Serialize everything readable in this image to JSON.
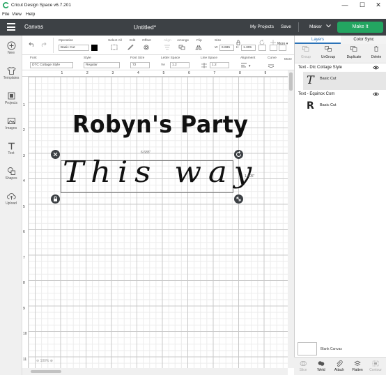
{
  "window": {
    "title": "Cricut Design Space  v6.7.201",
    "minimize": "—",
    "maximize": "☐",
    "close": "✕"
  },
  "menu": [
    "File",
    "View",
    "Help"
  ],
  "header": {
    "section": "Canvas",
    "document_title": "Untitled*",
    "my_projects": "My Projects",
    "save": "Save",
    "machine": "Maker",
    "make_it": "Make It",
    "make_it_color": "#23a561"
  },
  "sidebar": {
    "items": [
      {
        "label": "New",
        "icon": "plus-icon"
      },
      {
        "label": "Templates",
        "icon": "shirt-icon"
      },
      {
        "label": "Projects",
        "icon": "projects-icon"
      },
      {
        "label": "Images",
        "icon": "image-icon"
      },
      {
        "label": "Text",
        "icon": "text-icon"
      },
      {
        "label": "Shapes",
        "icon": "shapes-icon"
      },
      {
        "label": "Upload",
        "icon": "upload-icon"
      }
    ]
  },
  "toolbar": {
    "operation_label": "Operation",
    "operation_value": "Basic Cut",
    "operation_color": "#000000",
    "select_all": "Select All",
    "edit": "Edit",
    "offset": "Offset",
    "align": "Align",
    "arrange": "Arrange",
    "flip": "Flip",
    "size_label": "Size",
    "width_prefix": "W",
    "width_value": "6.685",
    "height_prefix": "H",
    "height_value": "1.305",
    "rotate": "Rotate",
    "position": "Position",
    "more": "More"
  },
  "text_toolbar": {
    "font_label": "Font",
    "font_value": "DTC Cottage Style",
    "style_label": "Style",
    "style_value": "Regular",
    "font_size_label": "Font Size",
    "font_size_value": "72",
    "letter_space_label": "Letter Space",
    "letter_space_prefix": "VA",
    "letter_space_value": "1.2",
    "line_space_label": "Line Space",
    "line_space_value": "1.2",
    "alignment_label": "Alignment",
    "curve_label": "Curve",
    "more": "More"
  },
  "canvas": {
    "ruler_top": [
      "1",
      "2",
      "3",
      "4",
      "5",
      "6",
      "7",
      "8",
      "9"
    ],
    "ruler_left": [
      "1",
      "2",
      "3",
      "4",
      "5",
      "6",
      "7",
      "8",
      "9",
      "10",
      "11"
    ],
    "heading_text": "Robyn's Party",
    "script_text": "This way",
    "width_dim": "6.685\"",
    "height_dim": "1.305\"",
    "zoom": "100%"
  },
  "panel": {
    "tabs": [
      "Layers",
      "Color Sync"
    ],
    "actions": [
      {
        "label": "Group",
        "icon": "group-icon",
        "enabled": false
      },
      {
        "label": "UnGroup",
        "icon": "ungroup-icon",
        "enabled": true
      },
      {
        "label": "Duplicate",
        "icon": "duplicate-icon",
        "enabled": true
      },
      {
        "label": "Delete",
        "icon": "trash-icon",
        "enabled": true
      }
    ],
    "layers": [
      {
        "title": "Text - Dtc Cottage Style",
        "child": "Basic Cut",
        "glyph": "T"
      },
      {
        "title": "Text - Equinox Com",
        "child": "Basic Cut",
        "glyph": "R"
      }
    ],
    "blank_canvas": "Blank Canvas",
    "bottom_actions": [
      "Slice",
      "Weld",
      "Attach",
      "Flatten",
      "Contour"
    ]
  }
}
